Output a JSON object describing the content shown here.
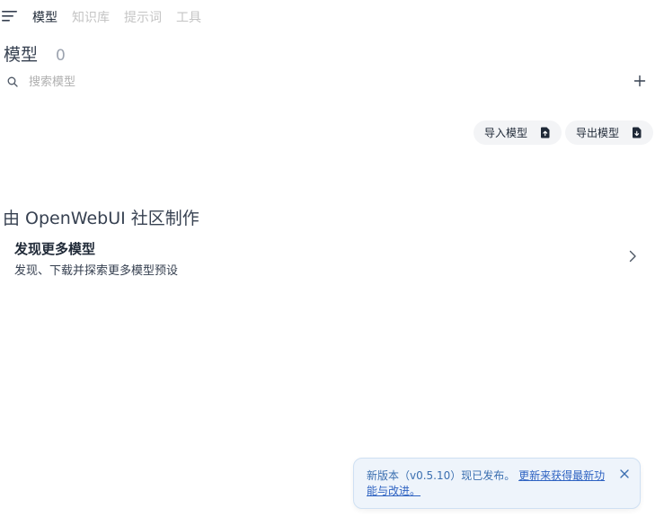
{
  "nav": {
    "menu_icon": "hamburger-menu-icon",
    "tabs": [
      {
        "label": "模型",
        "active": true
      },
      {
        "label": "知识库",
        "active": false
      },
      {
        "label": "提示词",
        "active": false
      },
      {
        "label": "工具",
        "active": false
      }
    ]
  },
  "models": {
    "title": "模型",
    "count": "0",
    "search_placeholder": "搜索模型",
    "search_value": "",
    "add_icon": "plus-icon"
  },
  "actions": {
    "import_label": "导入模型",
    "import_icon": "file-upload-icon",
    "export_label": "导出模型",
    "export_icon": "file-download-icon"
  },
  "community": {
    "title": "由 OpenWebUI 社区制作",
    "discover_title": "发现更多模型",
    "discover_desc": "发现、下载并探索更多模型预设",
    "chevron_icon": "chevron-right-icon"
  },
  "toast": {
    "message": "新版本（v0.5.10）现已发布。",
    "link_text": "更新来获得最新功能与改进。",
    "close_icon": "close-icon"
  },
  "colors": {
    "accent_link": "#2f63c2",
    "toast_bg": "#eef4fb",
    "pill_bg": "#f3f4f6",
    "muted_tab": "#c4c4c4"
  }
}
